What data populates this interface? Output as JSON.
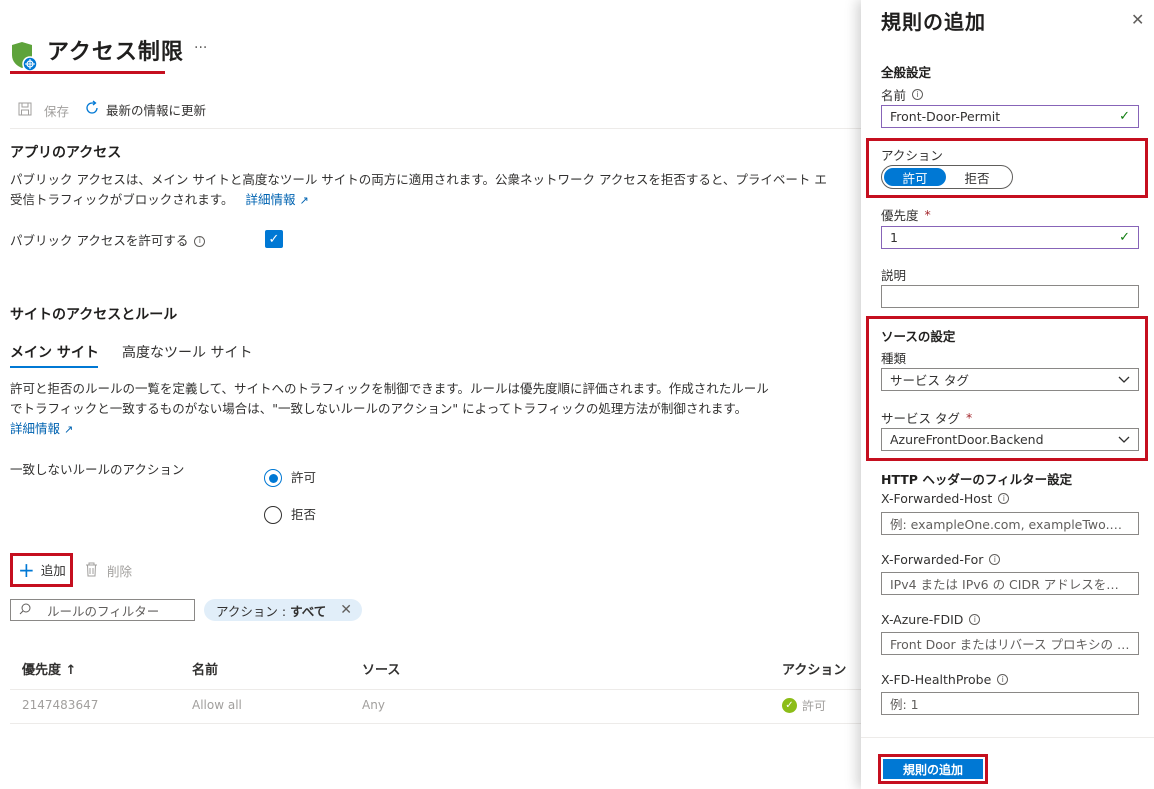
{
  "header": {
    "title": "アクセス制限",
    "more": "···"
  },
  "toolbar": {
    "save": "保存",
    "refresh": "最新の情報に更新"
  },
  "app_access": {
    "title": "アプリのアクセス",
    "description_line1": "パブリック アクセスは、メイン サイトと高度なツール サイトの両方に適用されます。公衆ネットワーク アクセスを拒否すると、プライベート エ",
    "description_line2": "受信トラフィックがブロックされます。",
    "learn_more": "詳細情報",
    "allow_public_label": "パブリック アクセスを許可する",
    "allow_public_checked": true
  },
  "site_access": {
    "title": "サイトのアクセスとルール",
    "tabs": [
      "メイン サイト",
      "高度なツール サイト"
    ],
    "description_line1": "許可と拒否のルールの一覧を定義して、サイトへのトラフィックを制御できます。ルールは優先度順に評価されます。作成されたルール",
    "description_line2": "でトラフィックと一致するものがない場合は、\"一致しないルールのアクション\" によってトラフィックの処理方法が制御されます。",
    "learn_more": "詳細情報",
    "unmatched_label": "一致しないルールのアクション",
    "option_allow": "許可",
    "option_deny": "拒否"
  },
  "rules_toolbar": {
    "add": "追加",
    "delete": "削除",
    "filter_placeholder": "ルールのフィルター",
    "pill_label": "アクション :",
    "pill_value": "すべて"
  },
  "table": {
    "headers": [
      "優先度 ↑",
      "名前",
      "ソース",
      "アクション"
    ],
    "rows": [
      {
        "priority": "2147483647",
        "name": "Allow all",
        "source": "Any",
        "action": "許可"
      }
    ]
  },
  "panel": {
    "title": "規則の追加",
    "general_heading": "全般設定",
    "name_label": "名前",
    "name_value": "Front-Door-Permit",
    "action_label": "アクション",
    "action_allow": "許可",
    "action_deny": "拒否",
    "priority_label": "優先度",
    "priority_value": "1",
    "description_label": "説明",
    "description_value": "",
    "source_heading": "ソースの設定",
    "type_label": "種類",
    "type_value": "サービス タグ",
    "service_tag_label": "サービス タグ",
    "service_tag_value": "AzureFrontDoor.Backend",
    "http_heading": "HTTP ヘッダーのフィルター設定",
    "xfh_label": "X-Forwarded-Host",
    "xfh_placeholder": "例: exampleOne.com, exampleTwo.…",
    "xff_label": "X-Forwarded-For",
    "xff_placeholder": "IPv4 または IPv6 の CIDR アドレスを入…",
    "fdid_label": "X-Azure-FDID",
    "fdid_placeholder": "Front Door またはリバース プロキシの ID …",
    "probe_label": "X-FD-HealthProbe",
    "probe_placeholder": "例: 1",
    "submit": "規則の追加"
  },
  "colors": {
    "accent": "#0078d4",
    "highlight": "#c50f1f",
    "success": "#107c10"
  }
}
